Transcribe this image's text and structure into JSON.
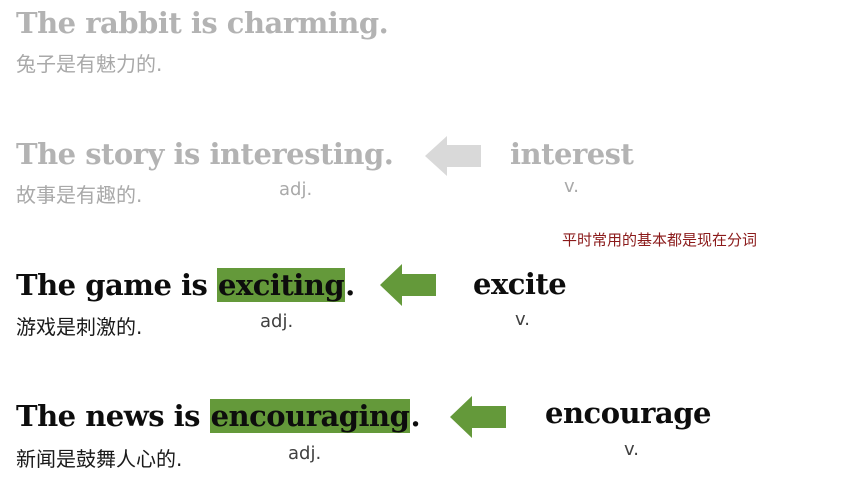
{
  "colors": {
    "highlight": "#64993a",
    "arrow_active": "#64993a",
    "arrow_faded": "#d9d9d9",
    "faded_text": "#b3b3b3",
    "note_text": "#8b1a1a"
  },
  "icons": {
    "arrow": "left-arrow-icon"
  },
  "rows": [
    {
      "sentence": "The rabbit is charming.",
      "translation": "兔子是有魅力的."
    },
    {
      "sentence_prefix": "The story is interesting.",
      "translation": "故事是有趣的.",
      "pos_adj": "adj.",
      "verb": "interest",
      "pos_verb": "v."
    },
    {
      "sentence_prefix": "The game is ",
      "sentence_highlight": "exciting",
      "sentence_suffix": ".",
      "translation": "游戏是刺激的.",
      "pos_adj": "adj.",
      "verb": "excite",
      "pos_verb": "v."
    },
    {
      "sentence_prefix": "The news is ",
      "sentence_highlight": "encouraging",
      "sentence_suffix": ".",
      "translation": "新闻是鼓舞人心的.",
      "pos_adj": "adj.",
      "verb": "encourage",
      "pos_verb": "v."
    }
  ],
  "note": "平时常用的基本都是现在分词"
}
